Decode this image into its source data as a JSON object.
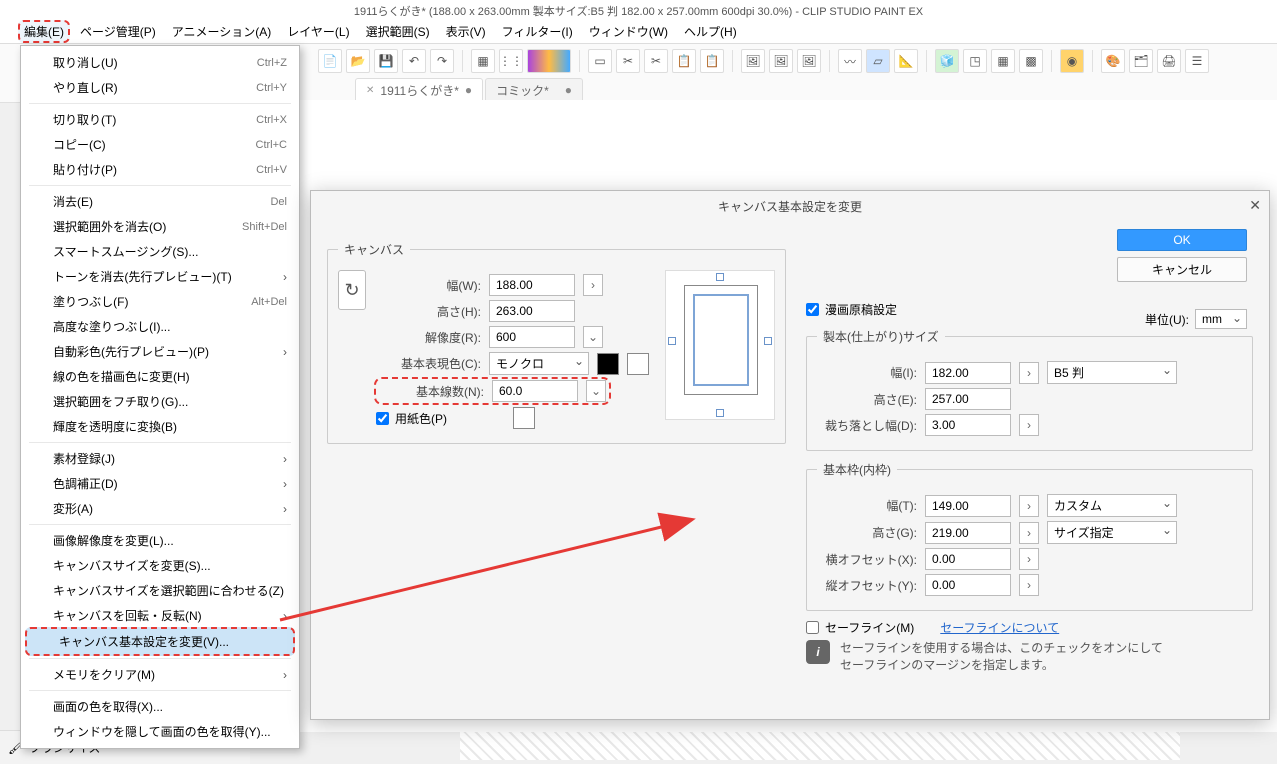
{
  "title": "1911らくがき* (188.00 x 263.00mm 製本サイズ:B5 判 182.00 x 257.00mm 600dpi 30.0%)  - CLIP STUDIO PAINT EX",
  "menubar": {
    "edit": "編集(E)",
    "page": "ページ管理(P)",
    "anim": "アニメーション(A)",
    "layer": "レイヤー(L)",
    "select": "選択範囲(S)",
    "view": "表示(V)",
    "filter": "フィルター(I)",
    "window": "ウィンドウ(W)",
    "help": "ヘルプ(H)"
  },
  "tabs": {
    "t1": "1911らくがき*",
    "t2": "コミック*"
  },
  "menu": {
    "undo": "取り消し(U)",
    "undo_sc": "Ctrl+Z",
    "redo": "やり直し(R)",
    "redo_sc": "Ctrl+Y",
    "cut": "切り取り(T)",
    "cut_sc": "Ctrl+X",
    "copy": "コピー(C)",
    "copy_sc": "Ctrl+C",
    "paste": "貼り付け(P)",
    "paste_sc": "Ctrl+V",
    "erase": "消去(E)",
    "erase_sc": "Del",
    "erase_out": "選択範囲外を消去(O)",
    "erase_out_sc": "Shift+Del",
    "smart": "スマートスムージング(S)...",
    "tone": "トーンを消去(先行プレビュー)(T)",
    "fill": "塗りつぶし(F)",
    "fill_sc": "Alt+Del",
    "advfill": "高度な塗りつぶし(I)...",
    "autocolor": "自動彩色(先行プレビュー)(P)",
    "linecolor": "線の色を描画色に変更(H)",
    "selborder": "選択範囲をフチ取り(G)...",
    "brightalpha": "輝度を透明度に変換(B)",
    "matreg": "素材登録(J)",
    "coloradj": "色調補正(D)",
    "transform": "変形(A)",
    "imgres": "画像解像度を変更(L)...",
    "canvsize": "キャンバスサイズを変更(S)...",
    "canvsel": "キャンバスサイズを選択範囲に合わせる(Z)",
    "canvrot": "キャンバスを回転・反転(N)",
    "canvbase": "キャンバス基本設定を変更(V)...",
    "clearmem": "メモリをクリア(M)",
    "getcolor": "画面の色を取得(X)...",
    "hidewin": "ウィンドウを隠して画面の色を取得(Y)..."
  },
  "dialog": {
    "title": "キャンバス基本設定を変更",
    "ok": "OK",
    "cancel": "キャンセル",
    "unit_label": "単位(U):",
    "unit_value": "mm",
    "canvas_legend": "キャンバス",
    "width_l": "幅(W):",
    "width_v": "188.00",
    "height_l": "高さ(H):",
    "height_v": "263.00",
    "res_l": "解像度(R):",
    "res_v": "600",
    "color_l": "基本表現色(C):",
    "color_v": "モノクロ",
    "lines_l": "基本線数(N):",
    "lines_v": "60.0",
    "paper_l": "用紙色(P)",
    "manga_check": "漫画原稿設定",
    "finish_legend": "製本(仕上がり)サイズ",
    "f_w_l": "幅(I):",
    "f_w_v": "182.00",
    "f_preset": "B5 判",
    "f_h_l": "高さ(E):",
    "f_h_v": "257.00",
    "bleed_l": "裁ち落とし幅(D):",
    "bleed_v": "3.00",
    "frame_legend": "基本枠(内枠)",
    "fr_w_l": "幅(T):",
    "fr_w_v": "149.00",
    "fr_preset": "カスタム",
    "fr_h_l": "高さ(G):",
    "fr_h_v": "219.00",
    "fr_size": "サイズ指定",
    "off_x_l": "横オフセット(X):",
    "off_x_v": "0.00",
    "off_y_l": "縦オフセット(Y):",
    "off_y_v": "0.00",
    "safe_l": "セーフライン(M)",
    "safe_link": "セーフラインについて",
    "safe_hint1": "セーフラインを使用する場合は、このチェックをオンにして",
    "safe_hint2": "セーフラインのマージンを指定します。"
  },
  "bottom": {
    "brushsize": "ブラシサイズ"
  }
}
